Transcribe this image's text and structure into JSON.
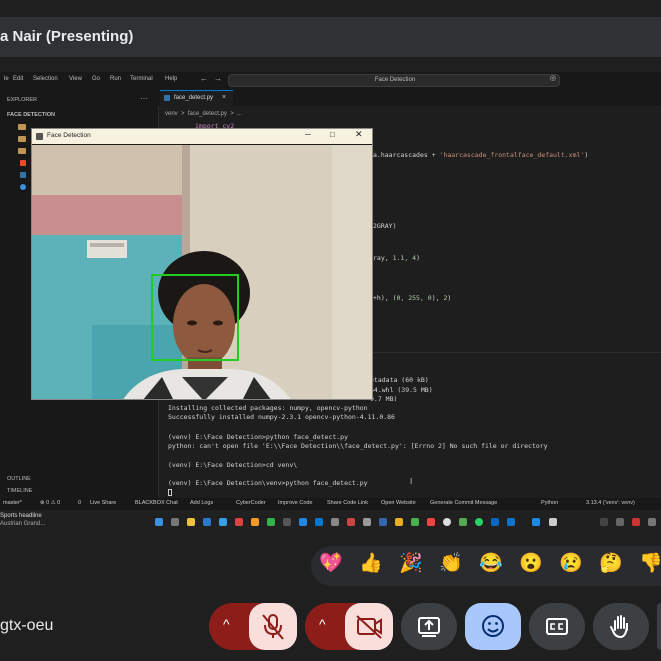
{
  "meet": {
    "presenter_label": "a Nair (Presenting)",
    "meeting_code": "gtx-oeu",
    "reactions": [
      "💖",
      "👍",
      "🎉",
      "👏",
      "😂",
      "😮",
      "😢",
      "🤔",
      "👎"
    ],
    "colors": {
      "accent": "#a8c7fa",
      "danger_bg": "#8c1d18",
      "danger_icon_bg": "#f9dedc"
    }
  },
  "vscode": {
    "menu": [
      "le",
      "Edit",
      "Selection",
      "View",
      "Go",
      "Run",
      "Terminal",
      "Help"
    ],
    "search_text": "Face Detection",
    "explorer_label": "EXPLORER",
    "folder_label": "FACE DETECTION",
    "tab_label": "face_detect.py",
    "breadcrumb": "venv  >  face_detect.py  >  ...",
    "code": {
      "line1": "import cv2",
      "line2_a": "a.haarcascades + ",
      "line2_b": "'haarcascade_frontalface_default.xml'",
      "line2_c": ")",
      "line3": "2GRAY)",
      "line4_a": "ray, ",
      "line4_b": "1.1, 4",
      "line4_c": ")",
      "line5_a": "+h), (",
      "line5_b": "0, 255, 0",
      "line5_c": "), ",
      "line5_d": "2",
      "line5_e": ")"
    },
    "terminal": [
      "etadata (60 kB)",
      "64.whl (39.5 MB)",
      "9.7 MB)",
      "Installing collected packages: numpy, opencv-python",
      "Successfully installed numpy-2.3.1 opencv-python-4.11.0.86",
      "",
      "(venv) E:\\Face Detection>python face_detect.py",
      "python: can't open file 'E:\\\\Face Detection\\\\face_detect.py': [Errno 2] No such file or directory",
      "",
      "(venv) E:\\Face Detection>cd venv\\",
      "",
      "(venv) E:\\Face Detection\\venv>python face_detect.py"
    ],
    "outline_label": "OUTLINE",
    "timeline_label": "TIMELINE",
    "status": {
      "branch": "master*",
      "problems": "⊗ 0 ⚠ 0",
      "ports": "0",
      "live_share": "Live Share",
      "blackbox": "BLACKBOX Chat",
      "add_logs": "Add Logs",
      "cybercoder": "CyberCoder",
      "improve": "Improve Code",
      "share": "Share Code Link",
      "website": "Open Website",
      "commit": "Generate Commit Message",
      "lang": "Python",
      "version": "3.13.4 ('venv': venv)"
    }
  },
  "taskbar": {
    "news_line1": "Sports headline",
    "news_line2": "Austrian Grand..."
  },
  "face_window": {
    "title": "Face Detection",
    "box_color": "#22cc22"
  }
}
